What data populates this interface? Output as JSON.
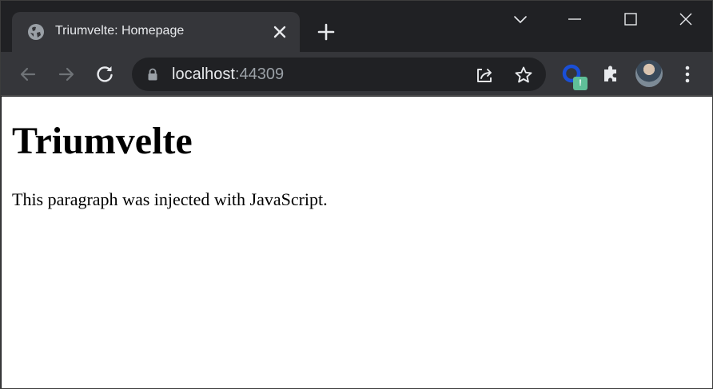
{
  "tab": {
    "title": "Triumvelte: Homepage",
    "favicon": "globe-icon"
  },
  "toolbar": {
    "url_host": "localhost",
    "url_port": ":44309",
    "extension_badge": "!"
  },
  "page": {
    "heading": "Triumvelte",
    "paragraph": "This paragraph was injected with JavaScript."
  },
  "colors": {
    "tabstrip_bg": "#202124",
    "toolbar_bg": "#35363a",
    "omnibox_bg": "#202124",
    "text_primary": "#e8eaed",
    "text_secondary": "#9aa0a6",
    "badge_bg": "#5fbf98"
  }
}
